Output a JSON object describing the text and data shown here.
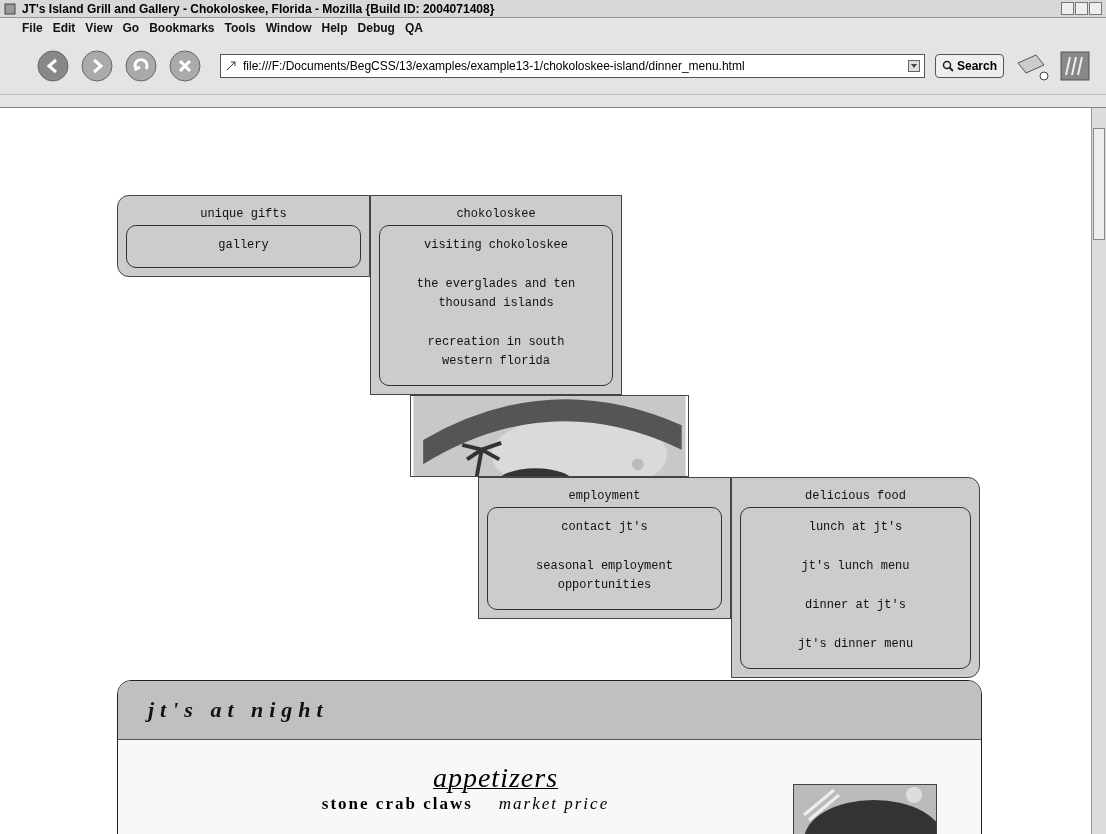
{
  "window": {
    "title": "JT's Island Grill and Gallery - Chokoloskee, Florida - Mozilla {Build ID: 2004071408}"
  },
  "menu_bar": [
    "File",
    "Edit",
    "View",
    "Go",
    "Bookmarks",
    "Tools",
    "Window",
    "Help",
    "Debug",
    "QA"
  ],
  "toolbar": {
    "address": "file:///F:/Documents/BegCSS/13/examples/example13-1/chokoloskee-island/dinner_menu.html",
    "search_button": "Search"
  },
  "nav_groups": [
    {
      "title": "unique gifts",
      "items": [
        "gallery"
      ]
    },
    {
      "title": "chokoloskee",
      "items": [
        "visiting chokoloskee",
        "the everglades and ten thousand islands",
        "recreation in south western florida"
      ]
    },
    {
      "title": "employment",
      "items": [
        "contact jt's",
        "seasonal employment opportunities"
      ]
    },
    {
      "title": "delicious food",
      "items": [
        "lunch at jt's",
        "jt's lunch menu",
        "dinner at jt's",
        "jt's dinner menu"
      ]
    }
  ],
  "panel": {
    "title": "jt's at night",
    "section": "appetizers",
    "item": {
      "name": "stone crab claws",
      "price": "market price"
    }
  }
}
